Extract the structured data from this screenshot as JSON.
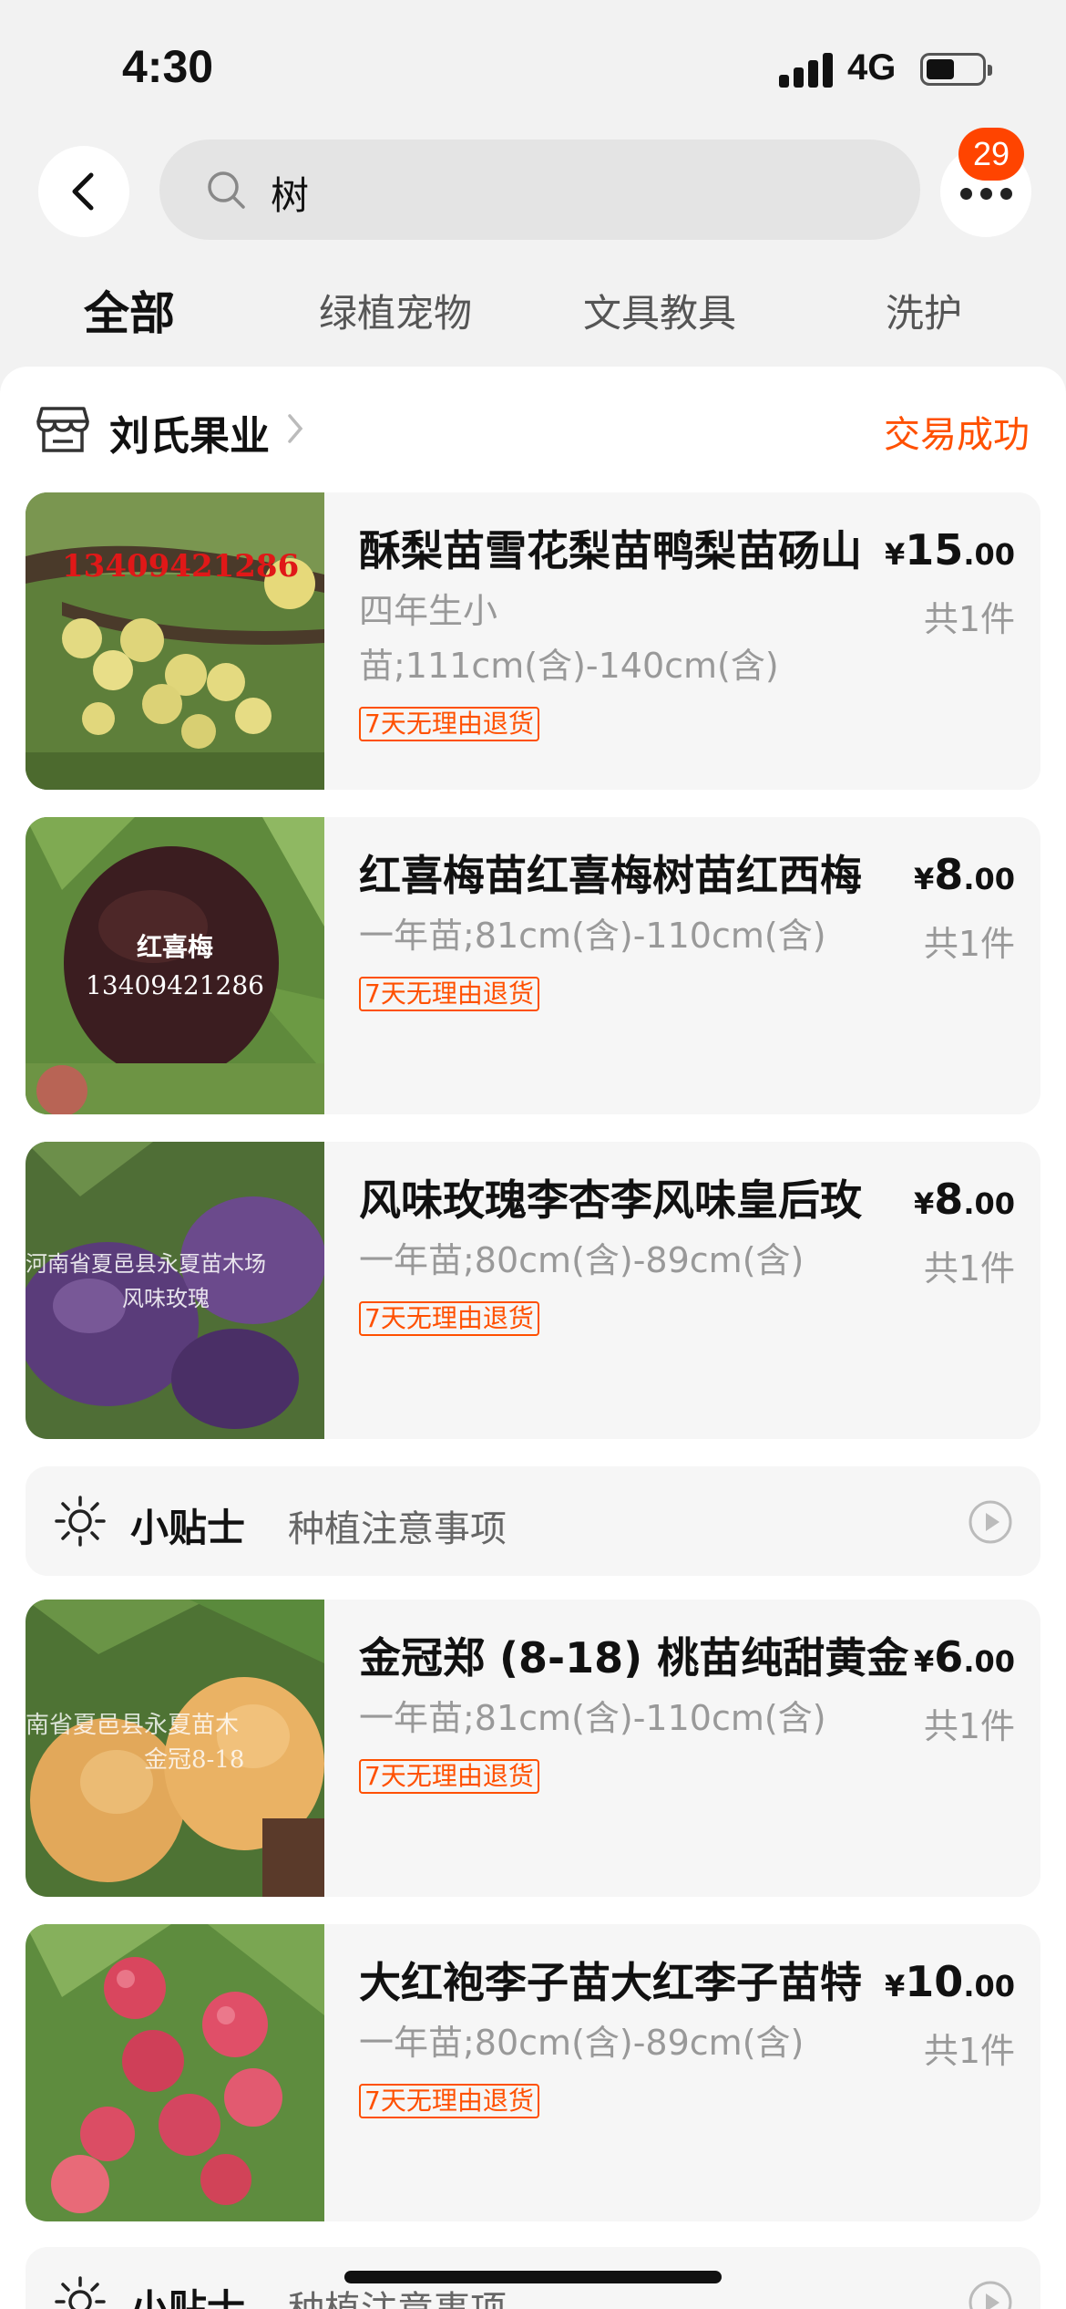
{
  "status_bar": {
    "time": "4:30",
    "network": "4G"
  },
  "search": {
    "query": "树",
    "badge_count": "29"
  },
  "tabs": [
    {
      "label": "全部",
      "active": true
    },
    {
      "label": "绿植宠物"
    },
    {
      "label": "文具教具"
    },
    {
      "label": "洗护"
    }
  ],
  "order": {
    "shop_name": "刘氏果业",
    "status": "交易成功"
  },
  "items": [
    {
      "title": "酥梨苗雪花梨苗鸭梨苗砀山",
      "spec": "四年生小苗;111cm(含)-140cm(含)",
      "tag": "7天无理由退货",
      "price_currency": "¥",
      "price_int": "15",
      "price_dec": ".00",
      "qty": "共1件",
      "image_text": "13409421286"
    },
    {
      "title": "红喜梅苗红喜梅树苗红西梅",
      "spec": "一年苗;81cm(含)-110cm(含)",
      "tag": "7天无理由退货",
      "price_currency": "¥",
      "price_int": "8",
      "price_dec": ".00",
      "qty": "共1件",
      "image_text": "红喜梅",
      "image_text2": "13409421286"
    },
    {
      "title": "风味玫瑰李杏李风味皇后玫",
      "spec": "一年苗;80cm(含)-89cm(含)",
      "tag": "7天无理由退货",
      "price_currency": "¥",
      "price_int": "8",
      "price_dec": ".00",
      "qty": "共1件",
      "image_text": "河南省夏邑县永夏苗木场",
      "image_text2": "风味玫瑰"
    },
    {
      "title": "金冠郑 (8-18) 桃苗纯甜黄金",
      "spec": "一年苗;81cm(含)-110cm(含)",
      "tag": "7天无理由退货",
      "price_currency": "¥",
      "price_int": "6",
      "price_dec": ".00",
      "qty": "共1件",
      "image_text": "南省夏邑县永夏苗木",
      "image_text2": "金冠8-18"
    },
    {
      "title": "大红袍李子苗大红李子苗特",
      "spec": "一年苗;80cm(含)-89cm(含)",
      "tag": "7天无理由退货",
      "price_currency": "¥",
      "price_int": "10",
      "price_dec": ".00",
      "qty": "共1件"
    }
  ],
  "tips": [
    {
      "label": "小贴士",
      "text": "种植注意事项"
    },
    {
      "label": "小贴士",
      "text": "种植注意事项"
    }
  ],
  "colors": {
    "accent": "#ff5000",
    "badge": "#ff4400",
    "page_bg": "#f2f2f2",
    "item_bg": "#f6f6f6"
  },
  "icons": {
    "back": "chevron-left-icon",
    "search": "search-icon",
    "more": "more-dots-icon",
    "shop": "store-icon",
    "tip": "lightbulb-icon",
    "play": "play-icon"
  }
}
